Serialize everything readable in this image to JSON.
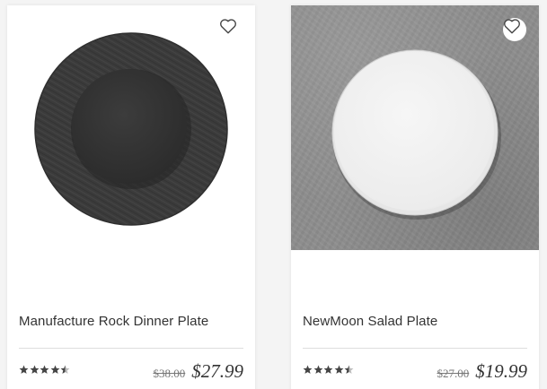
{
  "products": [
    {
      "name": "Manufacture Rock Dinner Plate",
      "old_price": "$38.00",
      "price": "$27.99",
      "rating": 4.5,
      "image": {
        "subject": "black-slate-dinner-plate",
        "background": "white"
      },
      "favorite_icon": "heart-outline-icon"
    },
    {
      "name": "NewMoon Salad Plate",
      "old_price": "$27.00",
      "price": "$19.99",
      "rating": 4.5,
      "image": {
        "subject": "white-salad-plate",
        "background": "grey-stone"
      },
      "favorite_icon": "heart-outline-icon"
    }
  ],
  "colors": {
    "text": "#333333",
    "muted": "#777777",
    "divider": "#dddddd",
    "star": "#444444",
    "slate_plate": "#3a3a3a",
    "stone_background": "#8e8e8e",
    "white_plate": "#f2f2f2"
  }
}
